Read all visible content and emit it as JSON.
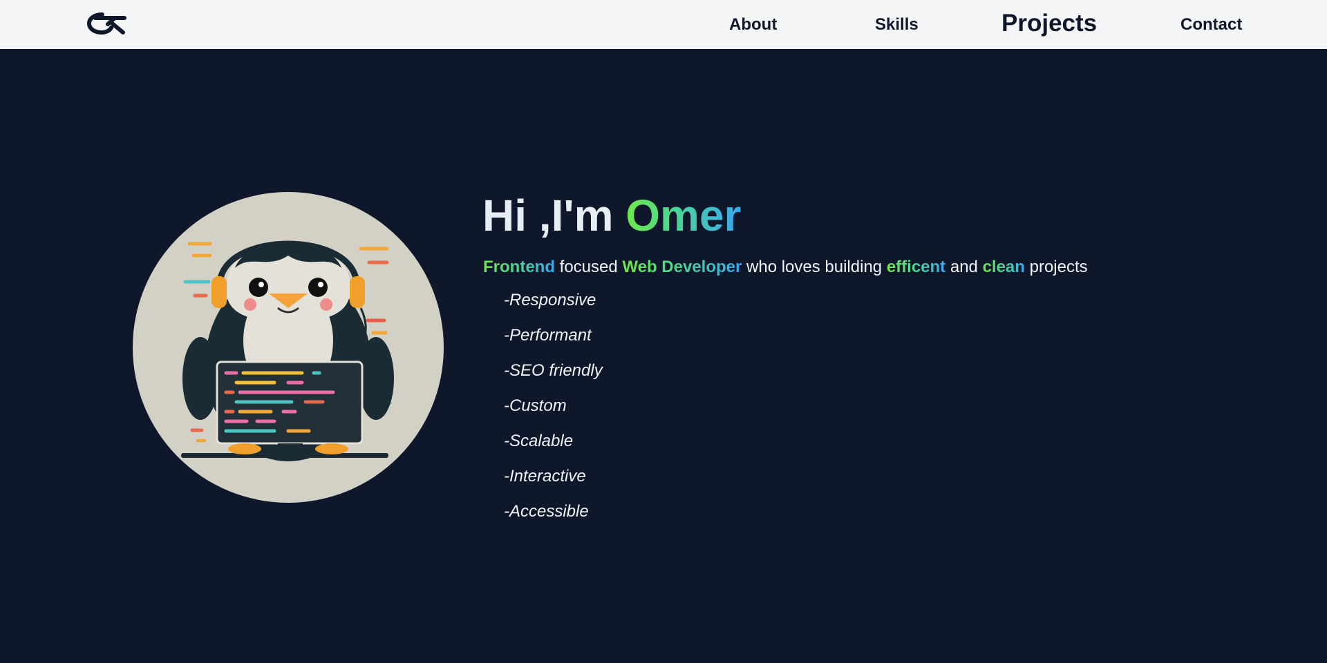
{
  "header": {
    "logo_icon": "ok-monogram-logo",
    "nav": {
      "about": "About",
      "skills": "Skills",
      "projects": "Projects",
      "contact": "Contact"
    }
  },
  "hero": {
    "avatar_icon": "penguin-coder-illustration",
    "title_prefix": "Hi ,I'm ",
    "title_name": "Omer",
    "tagline": {
      "w1": "Frontend",
      "t1": " focused ",
      "w2": "Web Developer",
      "t2": " who loves building ",
      "w3": "efficent",
      "t3": " and ",
      "w4": "clean",
      "t4": " projects"
    },
    "features": [
      "-Responsive",
      "-Performant",
      "-SEO friendly",
      "-Custom",
      "-Scalable",
      "-Interactive",
      "-Accessible"
    ]
  },
  "colors": {
    "background": "#0f172a",
    "navbar": "#f3f5f7",
    "accent_green": "#6ee849",
    "accent_blue": "#3aa6f0"
  }
}
